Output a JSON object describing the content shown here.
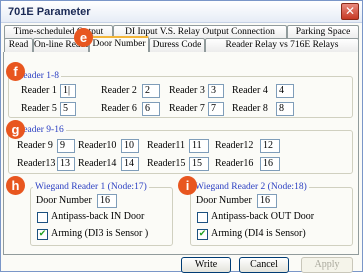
{
  "window": {
    "title": "701E Parameter",
    "close_glyph": "✕"
  },
  "tabs_row1": [
    "Time-scheduled Output",
    "DI Input V.S. Relay Output Connection",
    "Parking Space"
  ],
  "tabs_row2": [
    "Read",
    "On-line Reader",
    "Door Number",
    "Duress Code",
    "Reader Relay vs 716E Relays"
  ],
  "active_tab": "Door Number",
  "badges": [
    "e",
    "f",
    "g",
    "h",
    "i"
  ],
  "group_1_8": {
    "title": "Reader 1-8",
    "readers": [
      {
        "label": "Reader 1",
        "value": "1|"
      },
      {
        "label": "Reader 2",
        "value": "2"
      },
      {
        "label": "Reader 3",
        "value": "3"
      },
      {
        "label": "Reader 4",
        "value": "4"
      },
      {
        "label": "Reader 5",
        "value": "5"
      },
      {
        "label": "Reader 6",
        "value": "6"
      },
      {
        "label": "Reader 7",
        "value": "7"
      },
      {
        "label": "Reader 8",
        "value": "8"
      }
    ]
  },
  "group_9_16": {
    "title": "Reader 9-16",
    "readers": [
      {
        "label": "Reader 9",
        "value": "9"
      },
      {
        "label": "Reader10",
        "value": "10"
      },
      {
        "label": "Reader11",
        "value": "11"
      },
      {
        "label": "Reader12",
        "value": "12"
      },
      {
        "label": "Reader13",
        "value": "13"
      },
      {
        "label": "Reader14",
        "value": "14"
      },
      {
        "label": "Reader15",
        "value": "15"
      },
      {
        "label": "Reader16",
        "value": "16"
      }
    ]
  },
  "wiegand1": {
    "title": "Wiegand Reader 1 (Node:17)",
    "door_label": "Door Number",
    "door_value": "16",
    "antipass_label": "Antipass-back  IN  Door",
    "antipass_checked": false,
    "arming_label": "Arming (DI3 is Sensor )",
    "arming_checked": true
  },
  "wiegand2": {
    "title": "Wiegand Reader 2 (Node:18)",
    "door_label": "Door Number",
    "door_value": "16",
    "antipass_label": "Antipass-back  OUT  Door",
    "antipass_checked": false,
    "arming_label": "Arming (DI4 is Sensor)",
    "arming_checked": true
  },
  "buttons": {
    "write": "Write",
    "cancel": "Cancel",
    "apply": "Apply"
  },
  "colors": {
    "accent": "#e8561f",
    "group_title": "#2a3ec2",
    "active_tab_top": "#f3b63a"
  }
}
